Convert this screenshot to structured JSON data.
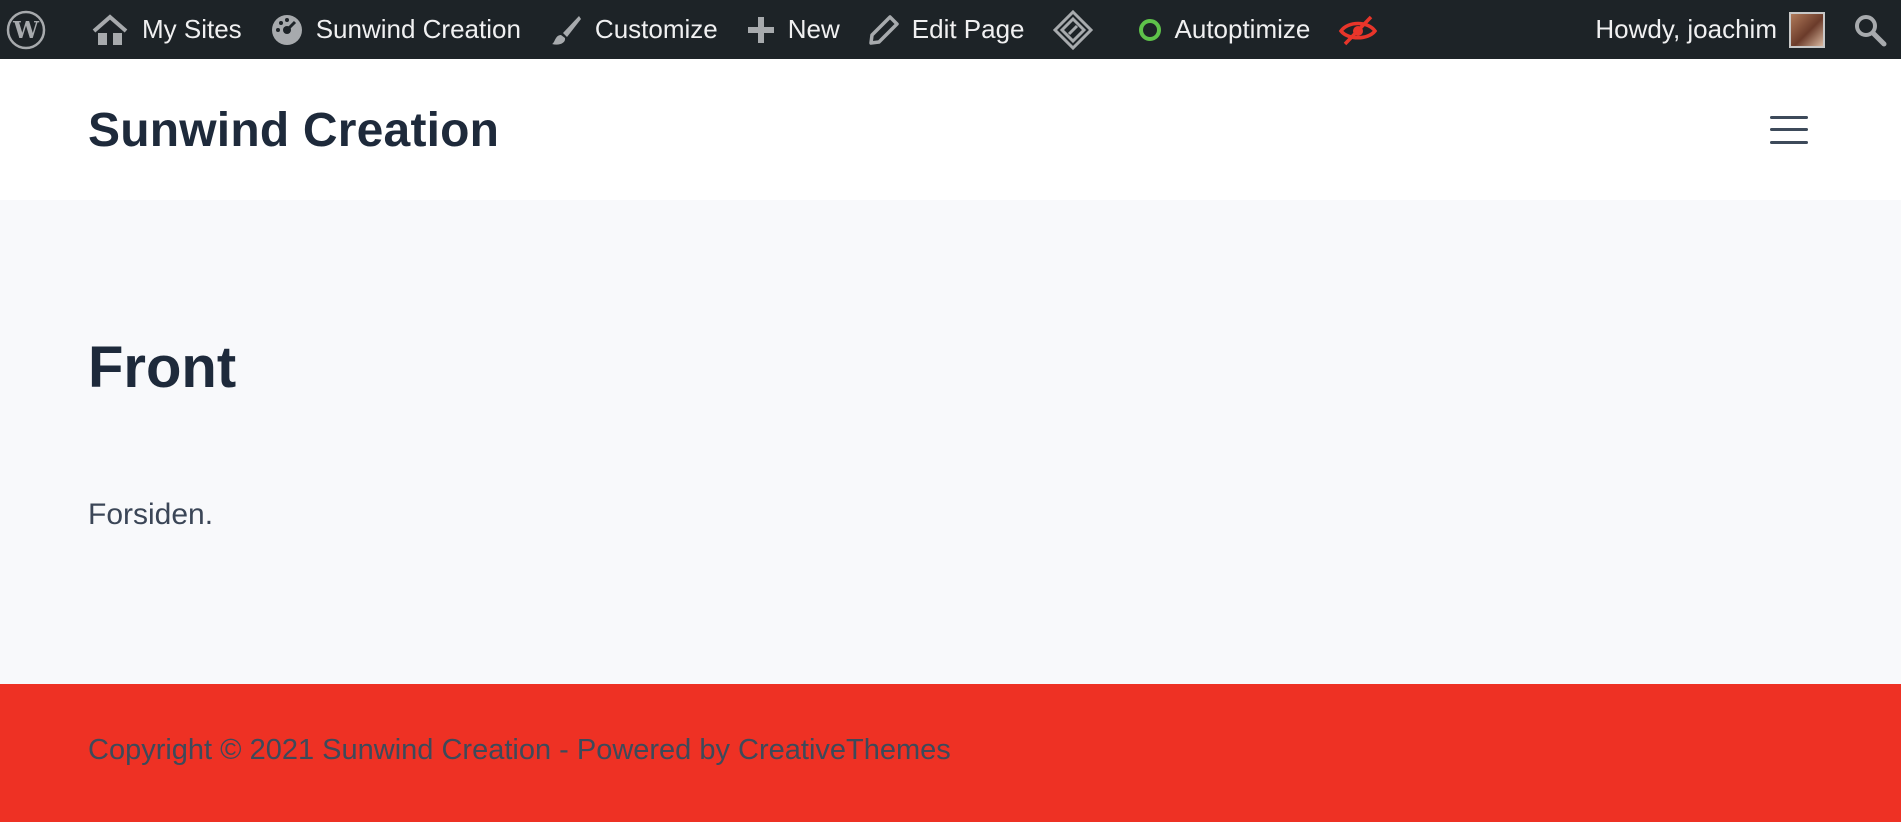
{
  "adminbar": {
    "my_sites": "My Sites",
    "site_name": "Sunwind Creation",
    "customize": "Customize",
    "new": "New",
    "edit_page": "Edit Page",
    "autoptimize": "Autoptimize",
    "howdy": "Howdy, joachim",
    "colors": {
      "background": "#1d2327",
      "autoptimize_status": "#5ec24a",
      "hidden_eye": "#e8352a"
    }
  },
  "header": {
    "site_title": "Sunwind Creation"
  },
  "main": {
    "title": "Front",
    "text": "Forsiden."
  },
  "footer": {
    "text": "Copyright © 2021 Sunwind Creation - Powered by CreativeThemes",
    "background": "#ee3124"
  }
}
